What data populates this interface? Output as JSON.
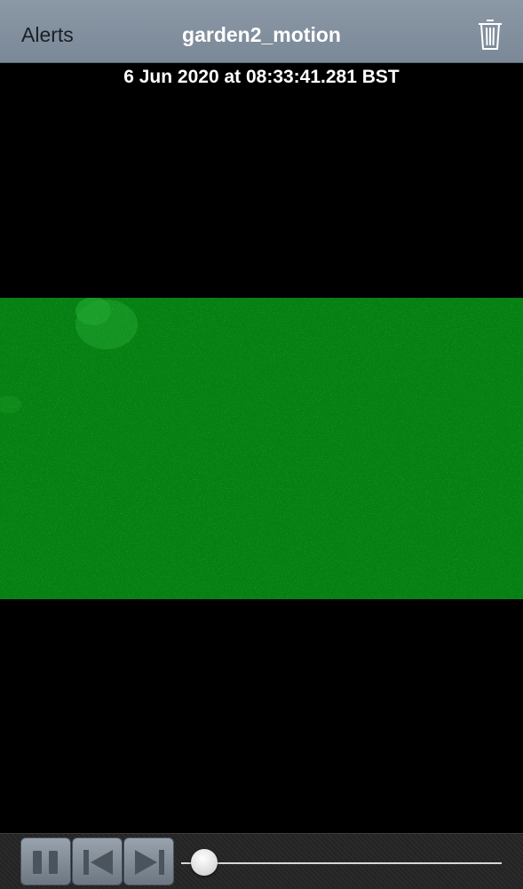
{
  "navbar": {
    "back_label": "Alerts",
    "title": "garden2_motion",
    "delete_icon": "trash-icon"
  },
  "video": {
    "timestamp": "6 Jun 2020 at 08:33:41.281 BST",
    "frame_color": "#067f12"
  },
  "playback": {
    "pause_icon": "pause-icon",
    "previous_icon": "skip-back-icon",
    "next_icon": "skip-forward-icon",
    "progress": 0.05
  }
}
